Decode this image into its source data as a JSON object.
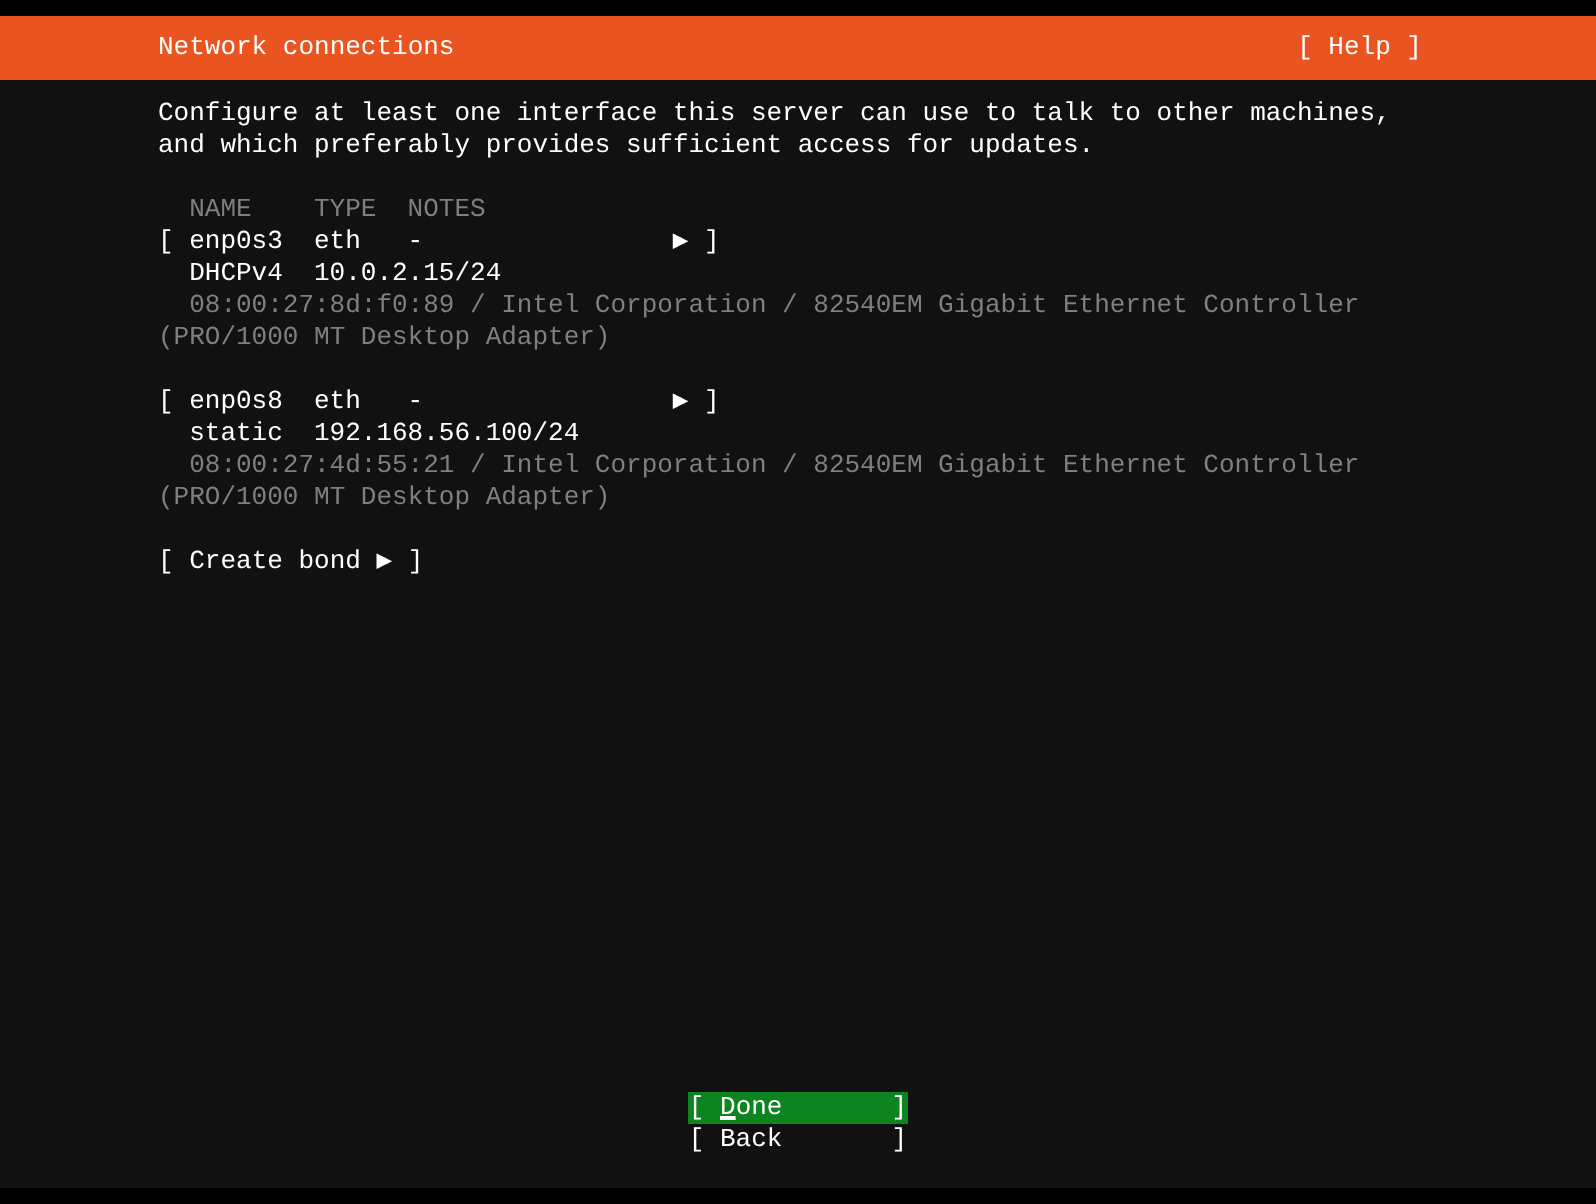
{
  "header": {
    "title": "Network connections",
    "help": "[ Help ]"
  },
  "description": "Configure at least one interface this server can use to talk to other machines, and which preferably provides sufficient access for updates.",
  "columns": [
    "NAME",
    "TYPE",
    "NOTES"
  ],
  "interfaces": [
    {
      "open": "[",
      "name": "enp0s3",
      "type": "eth",
      "notes": "-",
      "arrow": "▶",
      "close": "]",
      "method": "DHCPv4",
      "address": "10.0.2.15/24",
      "info": "08:00:27:8d:f0:89 / Intel Corporation / 82540EM Gigabit Ethernet Controller (PRO/1000 MT Desktop Adapter)"
    },
    {
      "open": "[",
      "name": "enp0s8",
      "type": "eth",
      "notes": "-",
      "arrow": "▶",
      "close": "]",
      "method": "static",
      "address": "192.168.56.100/24",
      "info": "08:00:27:4d:55:21 / Intel Corporation / 82540EM Gigabit Ethernet Controller (PRO/1000 MT Desktop Adapter)"
    }
  ],
  "create_bond": {
    "open": "[",
    "label": "Create bond",
    "arrow": "▶",
    "close": "]"
  },
  "buttons": [
    {
      "open": "[",
      "label": "Done",
      "close": "]",
      "selected": true
    },
    {
      "open": "[",
      "label": "Back",
      "close": "]",
      "selected": false
    }
  ]
}
